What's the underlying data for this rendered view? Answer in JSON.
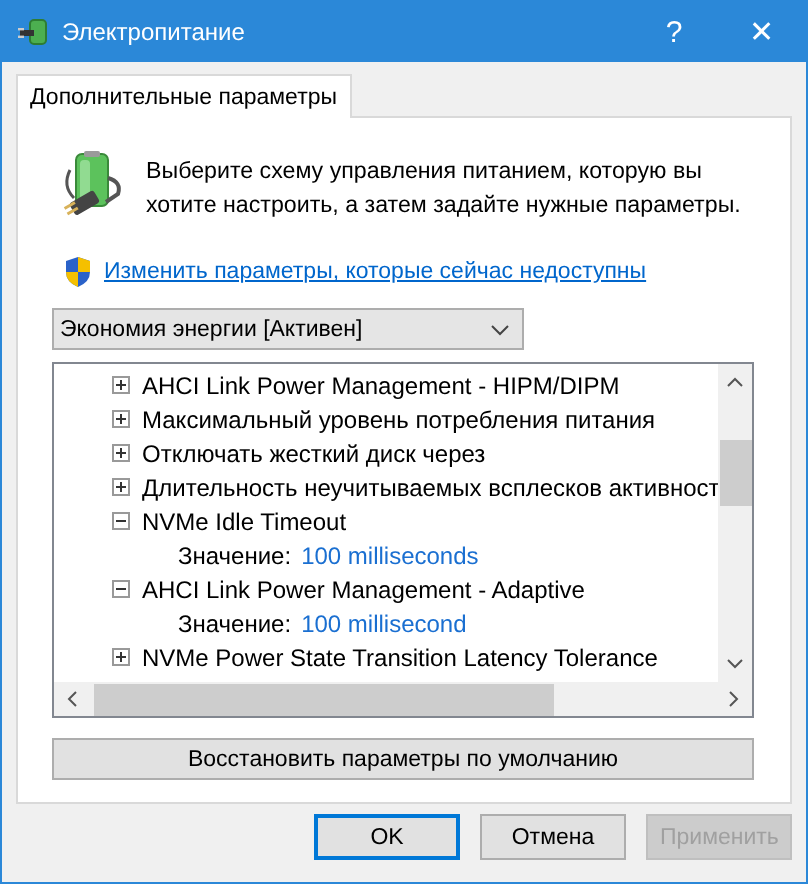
{
  "window": {
    "title": "Электропитание",
    "help": "?",
    "close": "✕"
  },
  "tabs": [
    {
      "label": "Дополнительные параметры",
      "selected": true
    }
  ],
  "intro": "Выберите схему управления питанием, которую вы хотите настроить, а затем задайте нужные параметры.",
  "link": "Изменить параметры, которые сейчас недоступны",
  "plan_dropdown": {
    "value": "Экономия энергии [Активен]"
  },
  "tree": [
    {
      "label": "AHCI Link Power Management - HIPM/DIPM",
      "expanded": false
    },
    {
      "label": "Максимальный уровень потребления питания",
      "expanded": false
    },
    {
      "label": "Отключать жесткий диск через",
      "expanded": false
    },
    {
      "label": "Длительность неучитываемых всплесков активност",
      "expanded": false
    },
    {
      "label": "NVMe Idle Timeout",
      "expanded": true,
      "children": [
        {
          "label": "Значение:",
          "value": "100 milliseconds"
        }
      ]
    },
    {
      "label": "AHCI Link Power Management - Adaptive",
      "expanded": true,
      "children": [
        {
          "label": "Значение:",
          "value": "100 millisecond"
        }
      ]
    },
    {
      "label": "NVMe Power State Transition Latency Tolerance",
      "expanded": false
    }
  ],
  "restore_button": "Восстановить параметры по умолчанию",
  "buttons": [
    {
      "label": "OK",
      "kind": "default",
      "disabled": false
    },
    {
      "label": "Отмена",
      "kind": "normal",
      "disabled": false
    },
    {
      "label": "Применить",
      "kind": "normal",
      "disabled": true
    }
  ]
}
